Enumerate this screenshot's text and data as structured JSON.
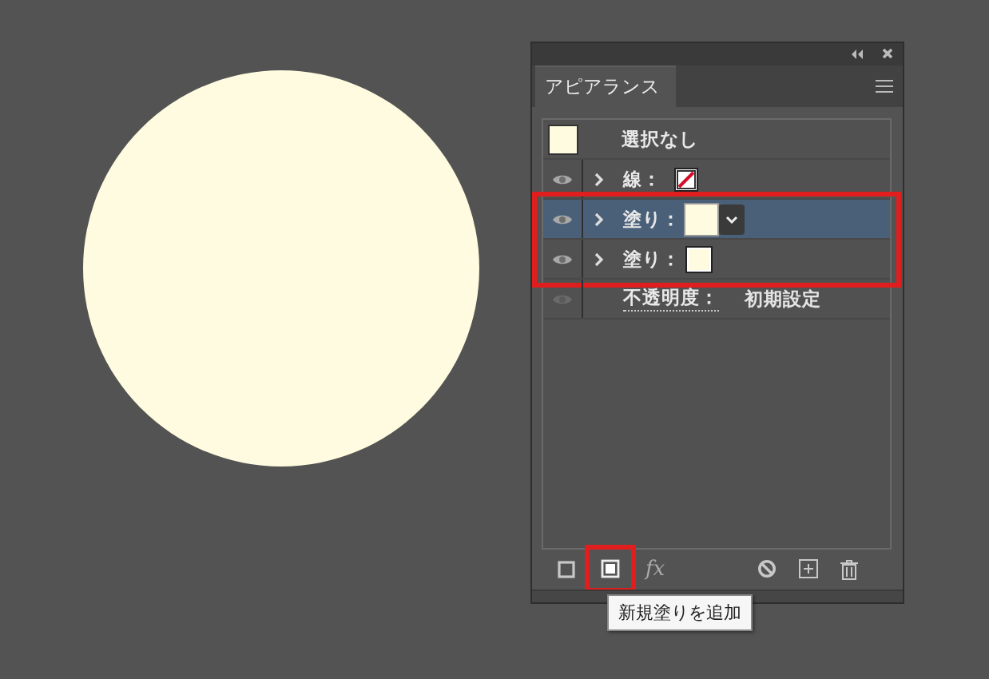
{
  "panel": {
    "title": "アピアランス",
    "selection": {
      "label": "選択なし"
    },
    "attributes": [
      {
        "kind": "stroke",
        "label": "線：",
        "selected": false,
        "highlighted": false,
        "eye_disabled": false
      },
      {
        "kind": "fill",
        "label": "塗り：",
        "selected": true,
        "highlighted": true,
        "eye_disabled": false
      },
      {
        "kind": "fill",
        "label": "塗り：",
        "selected": false,
        "highlighted": true,
        "eye_disabled": false
      },
      {
        "kind": "opacity",
        "label": "不透明度：",
        "value": "初期設定",
        "selected": false,
        "highlighted": false,
        "eye_disabled": true
      }
    ],
    "footer": [
      {
        "kind": "stroke",
        "highlighted": false
      },
      {
        "kind": "fill",
        "highlighted": true
      },
      {
        "kind": "fx",
        "text": "fx",
        "highlighted": false
      },
      {
        "kind": "clear",
        "highlighted": false
      },
      {
        "kind": "duplicate",
        "highlighted": false
      },
      {
        "kind": "delete",
        "highlighted": false
      }
    ],
    "tooltip": "新規塗りを追加"
  }
}
